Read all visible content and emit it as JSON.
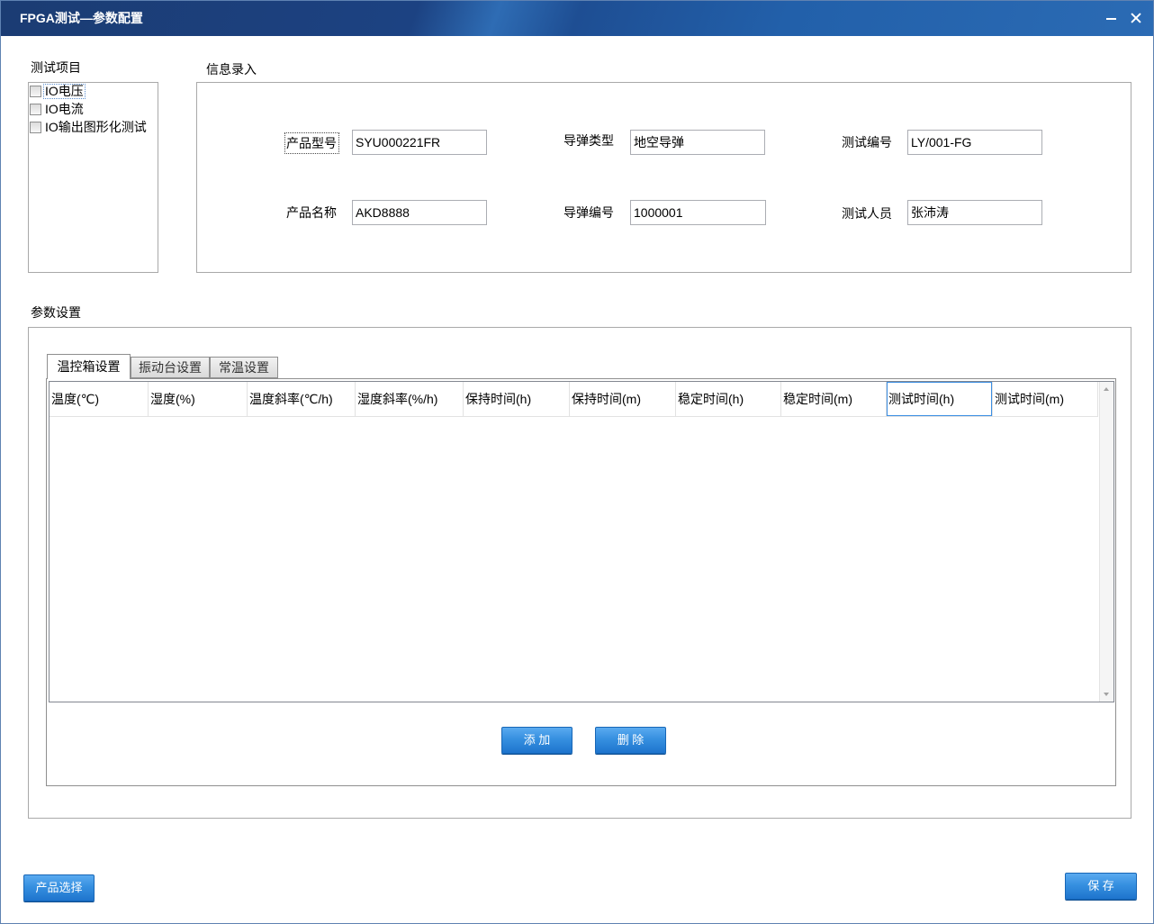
{
  "window": {
    "title": "FPGA测试—参数配置",
    "minimize_icon": "minimize-icon",
    "close_icon": "close-icon"
  },
  "test_items": {
    "label": "测试项目",
    "items": [
      {
        "label": "IO电压",
        "checked": false
      },
      {
        "label": "IO电流",
        "checked": false
      },
      {
        "label": "IO输出图形化测试",
        "checked": false
      }
    ]
  },
  "info": {
    "label": "信息录入",
    "fields": [
      {
        "label": "产品型号",
        "value": "SYU000221FR"
      },
      {
        "label": "导弹类型",
        "value": "地空导弹"
      },
      {
        "label": "测试编号",
        "value": "LY/001-FG"
      },
      {
        "label": "产品名称",
        "value": "AKD8888"
      },
      {
        "label": "导弹编号",
        "value": "1000001"
      },
      {
        "label": "测试人员",
        "value": "张沛涛"
      }
    ]
  },
  "params": {
    "label": "参数设置",
    "tabs": [
      {
        "label": "温控箱设置",
        "selected": true
      },
      {
        "label": "振动台设置",
        "selected": false
      },
      {
        "label": "常温设置",
        "selected": false
      }
    ],
    "table": {
      "columns": [
        "温度(℃)",
        "湿度(%)",
        "温度斜率(℃/h)",
        "湿度斜率(%/h)",
        "保持时间(h)",
        "保持时间(m)",
        "稳定时间(h)",
        "稳定时间(m)",
        "测试时间(h)",
        "测试时间(m)"
      ],
      "rows": [],
      "scroll_up_icon": "scroll-up-icon",
      "scroll_down_icon": "scroll-down-icon"
    },
    "add_button": "添 加",
    "delete_button": "删 除"
  },
  "footer": {
    "product_select_button": "产品选择",
    "save_button": "保 存"
  },
  "colors": {
    "titlebar_dark": "#1b3c73",
    "titlebar_light": "#2b6bb4",
    "button_top": "#5aaaf0",
    "button_bottom": "#1e74cd",
    "button_border": "#1766b6",
    "focus_border": "#3c8fe3"
  }
}
